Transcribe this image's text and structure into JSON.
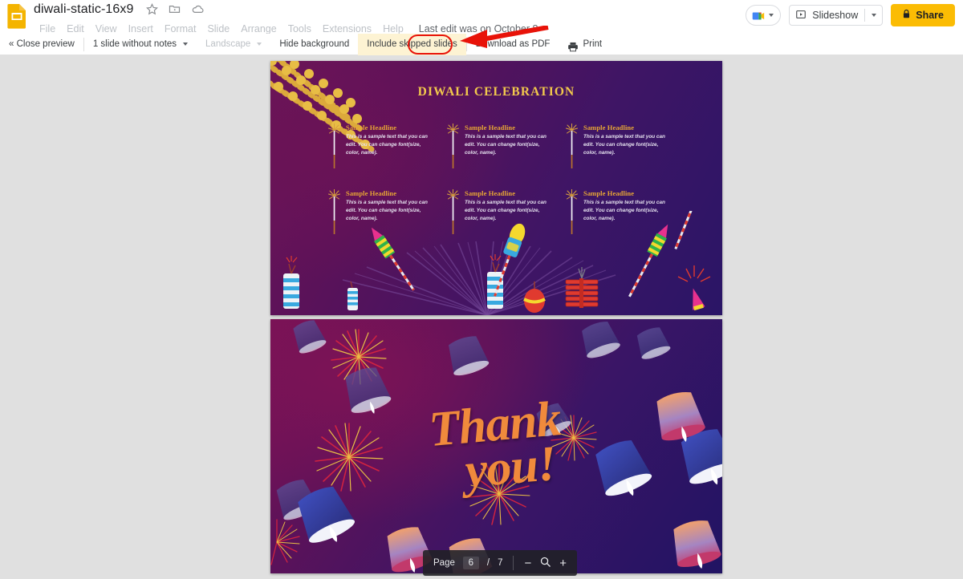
{
  "header": {
    "app_icon": "google-slides-icon",
    "doc_title": "diwali-static-16x9",
    "title_icons": [
      "star-icon",
      "move-to-folder-icon",
      "cloud-saved-icon"
    ],
    "menus": [
      "File",
      "Edit",
      "View",
      "Insert",
      "Format",
      "Slide",
      "Arrange",
      "Tools",
      "Extensions",
      "Help"
    ],
    "last_edit": "Last edit was on October 8",
    "meet_icon": "google-meet-icon",
    "slideshow_label": "Slideshow",
    "share_label": "Share",
    "share_icon": "lock-icon",
    "share_bg": "#fbbc04"
  },
  "preview_toolbar": {
    "close_label": "« Close preview",
    "notes_label": "1 slide without notes",
    "orientation_label": "Landscape",
    "orientation_disabled": true,
    "hide_background_label": "Hide background",
    "include_skipped_label": "Include skipped slides",
    "include_skipped_highlight": "#fdf3d3",
    "download_label": "Download as PDF",
    "print_label": "Print",
    "print_icon": "printer-icon"
  },
  "annotation": {
    "color": "#e81309",
    "target": "print-button",
    "shape": "ellipse-and-arrow"
  },
  "slides": [
    {
      "index": 1,
      "title": "DIWALI CELEBRATION",
      "title_color": "#f2c94c",
      "bg_colors": [
        "#6e1458",
        "#3f1565",
        "#2a1566"
      ],
      "decor": [
        "marigold-garland",
        "sparklers",
        "firecrackers",
        "rockets"
      ],
      "cells": [
        {
          "headline": "Sample Headline",
          "body": "This is a sample text that you can edit. You can change font(size, color, name)."
        },
        {
          "headline": "Sample Headline",
          "body": "This is a sample text that you can edit. You can change font(size, color, name)."
        },
        {
          "headline": "Sample Headline",
          "body": "This is a sample text that you can edit. You can change font(size, color, name)."
        },
        {
          "headline": "Sample Headline",
          "body": "This is a sample text that you can edit. You can change font(size, color, name)."
        },
        {
          "headline": "Sample Headline",
          "body": "This is a sample text that you can edit. You can change font(size, color, name)."
        },
        {
          "headline": "Sample Headline",
          "body": "This is a sample text that you can edit. You can change font(size, color, name)."
        }
      ]
    },
    {
      "index": 2,
      "thankyou_line1": "Thank",
      "thankyou_line2": "you!",
      "text_color": "#f08a3c",
      "bg_colors": [
        "#7a1256",
        "#3a1566",
        "#211463"
      ],
      "decor": [
        "sky-lanterns",
        "firework-bursts"
      ]
    }
  ],
  "page_controls": {
    "page_label": "Page",
    "current_page": "6",
    "separator": "/",
    "total_pages": "7",
    "zoom_out": "−",
    "zoom_icon": "magnifier-icon",
    "zoom_in": "+"
  }
}
